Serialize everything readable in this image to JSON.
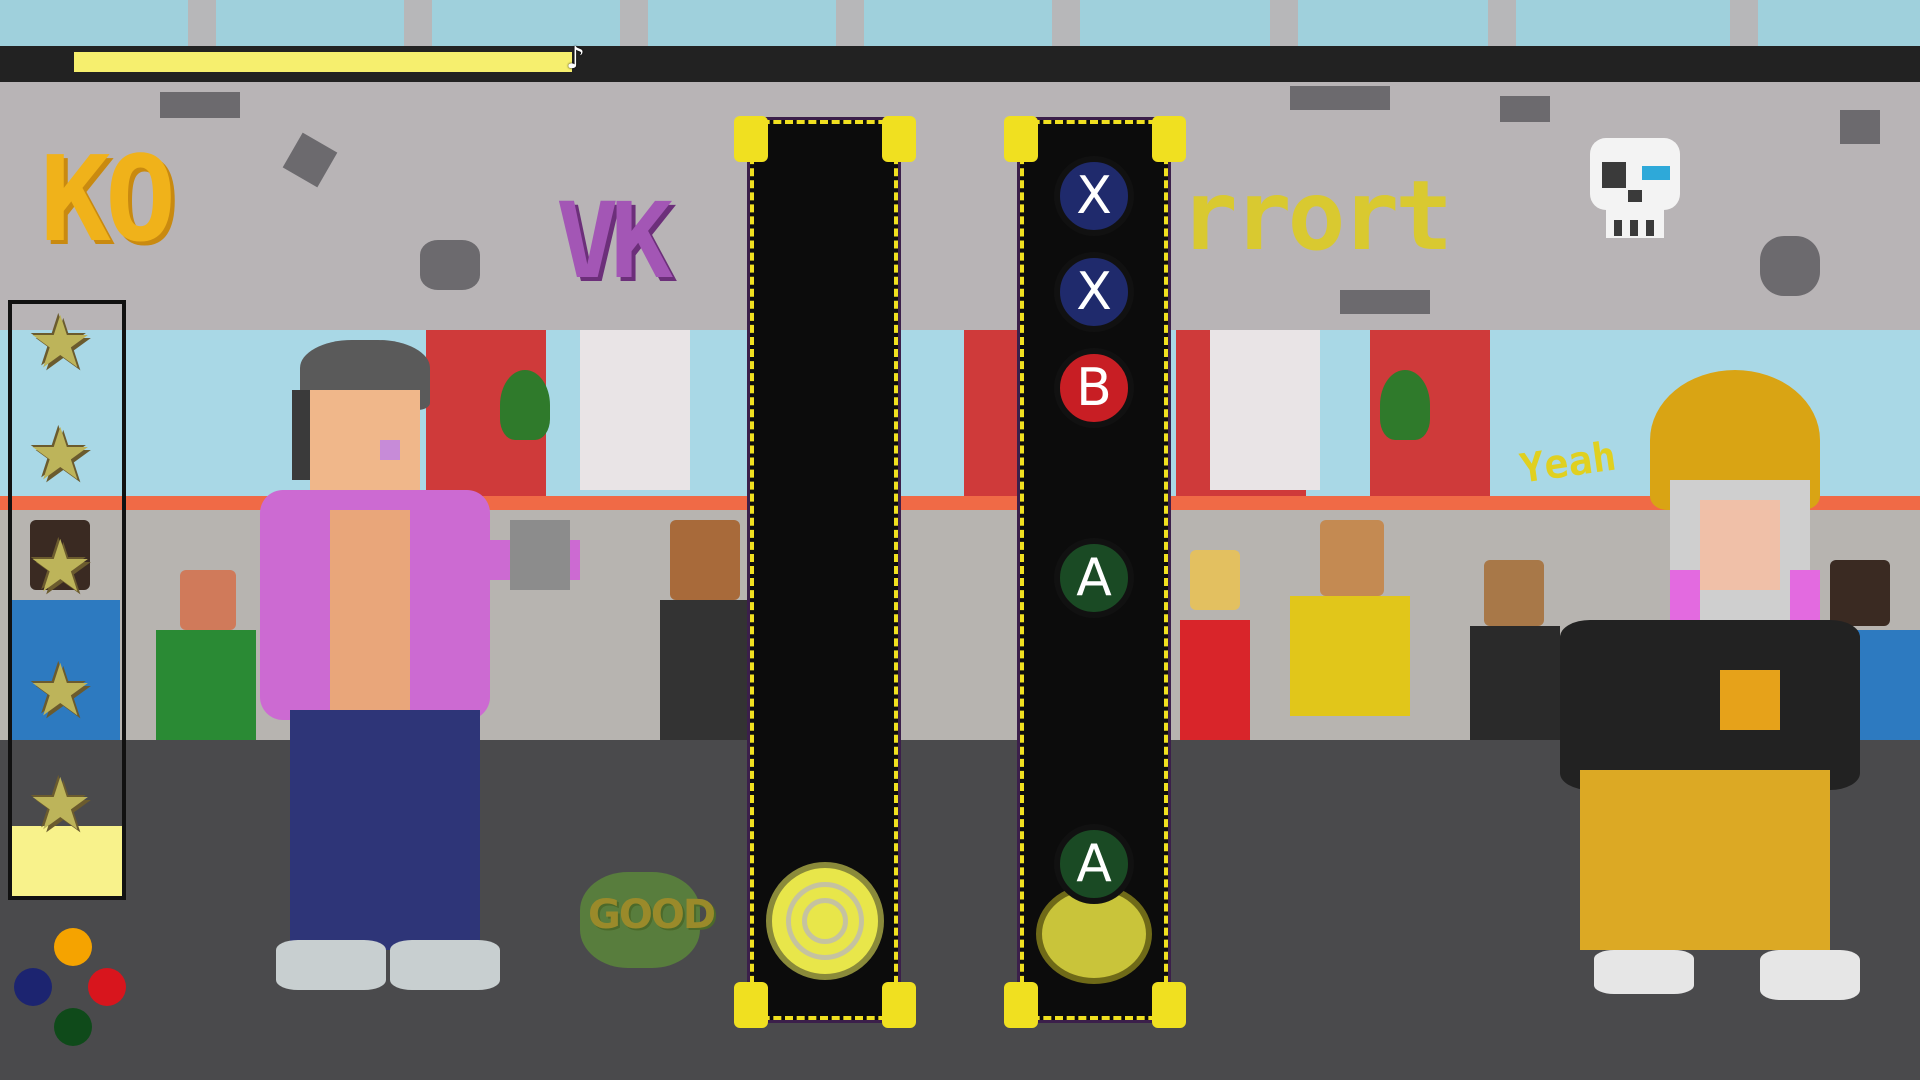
{
  "hud": {
    "song_progress": 0.27,
    "note_icon": "♪",
    "feedback_text": "GOOD"
  },
  "background": {
    "graffiti_left": "KO",
    "graffiti_mid": "VK",
    "graffiti_right": "rrort",
    "crowd_shout": "Yeah"
  },
  "star_meter": {
    "stars_total": 5,
    "fill_level": 0.12,
    "star_glyph": "★"
  },
  "controller_legend": {
    "top": "#f5a300",
    "left": "#1c2470",
    "right": "#d8151d",
    "bottom": "#0f4a1a"
  },
  "lanes": {
    "right_lane_notes": [
      {
        "label": "X",
        "type": "x"
      },
      {
        "label": "X",
        "type": "x"
      },
      {
        "label": "B",
        "type": "b"
      },
      {
        "label": "A",
        "type": "a"
      },
      {
        "label": "A",
        "type": "a"
      }
    ]
  },
  "colors": {
    "lane_border": "#f0e020",
    "progress_fill": "#f6ef6e",
    "star_fill": "#f8f28b"
  },
  "icons": {
    "note": "music-note-icon",
    "star": "star-icon",
    "skull": "skull-icon"
  }
}
